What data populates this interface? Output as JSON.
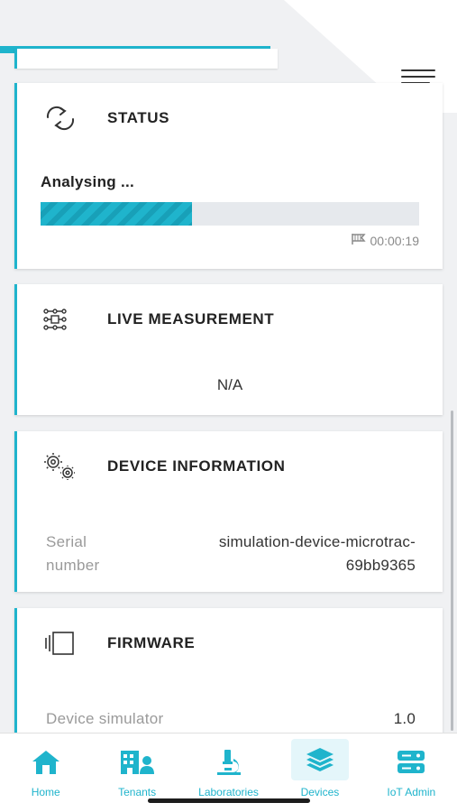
{
  "status_card": {
    "title": "STATUS",
    "label": "Analysing ...",
    "progress": 0.4,
    "elapsed": "00:00:19"
  },
  "live_card": {
    "title": "LIVE MEASUREMENT",
    "value": "N/A"
  },
  "device_card": {
    "title": "DEVICE INFORMATION",
    "serial_key": "Serial number",
    "serial_value": "simulation-device-microtrac-69bb9365"
  },
  "firmware_card": {
    "title": "FIRMWARE",
    "key": "Device simulator",
    "value": "1.0"
  },
  "tabs": [
    {
      "label": "Home",
      "icon": "home-icon"
    },
    {
      "label": "Tenants",
      "icon": "tenants-icon"
    },
    {
      "label": "Laboratories",
      "icon": "microscope-icon"
    },
    {
      "label": "Devices",
      "icon": "layers-icon"
    },
    {
      "label": "IoT Admin",
      "icon": "server-icon"
    }
  ],
  "active_tab": "Devices",
  "colors": {
    "accent": "#1fb4cc",
    "background": "#f0f1f3"
  }
}
